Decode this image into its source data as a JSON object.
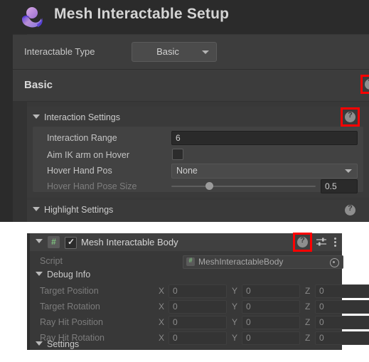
{
  "window": {
    "title": "Mesh Interactable Setup",
    "logo_icon": "mesh-logo-icon"
  },
  "colors": {
    "panel_bg": "#383838",
    "header_bg": "#2b2b2b",
    "accent_red": "#ff0000",
    "logo_purple": "#5b3fd9",
    "logo_lavender": "#c79ad9",
    "script_green": "#7ec07e"
  },
  "setup_panel": {
    "interactable_type": {
      "label": "Interactable Type",
      "value": "Basic",
      "options": [
        "Basic"
      ],
      "help_icon": "help-icon",
      "help_highlighted": true
    },
    "basic_section": {
      "title": "Basic",
      "help_icon": "help-icon",
      "help_highlighted": true
    },
    "interaction_settings": {
      "title": "Interaction Settings",
      "expanded": true,
      "help_icon": "help-icon",
      "help_highlighted": true,
      "fields": [
        {
          "label": "Interaction Range",
          "type": "number",
          "value": "6",
          "disabled": false
        },
        {
          "label": "Aim IK arm on Hover",
          "type": "checkbox",
          "checked": false,
          "disabled": false
        },
        {
          "label": "Hover Hand Pos",
          "type": "dropdown",
          "value": "None",
          "disabled": false
        },
        {
          "label": "Hover Hand Pose Size",
          "type": "slider",
          "value": "0.5",
          "percent": 50,
          "disabled": true
        }
      ]
    },
    "highlight_settings": {
      "title": "Highlight Settings",
      "expanded": true,
      "help_icon": "help-icon",
      "help_highlighted": false
    }
  },
  "component_panel": {
    "header": {
      "title": "Mesh Interactable Body",
      "enabled": true,
      "expanded": true,
      "script_icon": "script-icon",
      "script_glyph": "#",
      "help_icon": "help-icon",
      "help_highlighted": true,
      "preset_icon": "preset-icon",
      "menu_icon": "kebab-menu-icon"
    },
    "script_row": {
      "label": "Script",
      "value": "MeshInteractableBody",
      "picker_icon": "object-picker-icon"
    },
    "debug_info": {
      "title": "Debug Info",
      "expanded": true,
      "rows": [
        {
          "label": "Target Position",
          "x": "0",
          "y": "0",
          "z": "0"
        },
        {
          "label": "Target Rotation",
          "x": "0",
          "y": "0",
          "z": "0"
        },
        {
          "label": "Ray Hit Position",
          "x": "0",
          "y": "0",
          "z": "0"
        },
        {
          "label": "Ray Hit Rotation",
          "x": "0",
          "y": "0",
          "z": "0"
        }
      ],
      "axis_labels": [
        "X",
        "Y",
        "Z"
      ]
    },
    "settings_section": {
      "title": "Settings",
      "expanded": true
    }
  }
}
